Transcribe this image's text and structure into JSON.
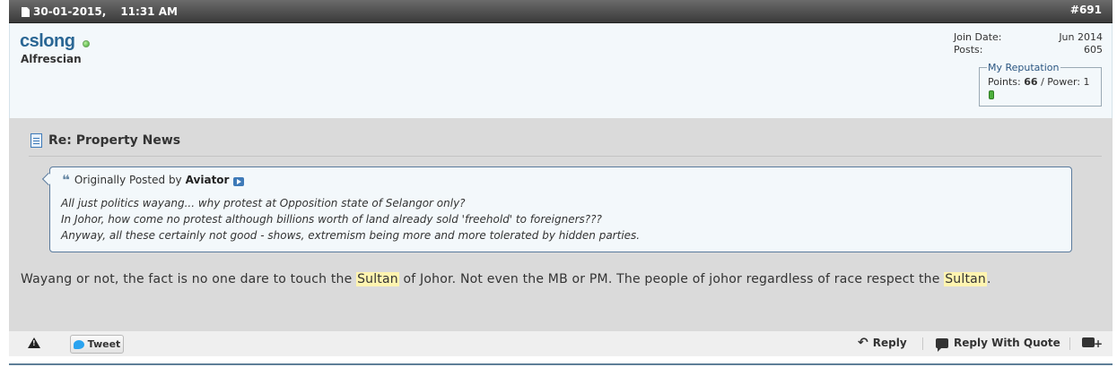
{
  "post": {
    "date": "30-01-2015,",
    "time": "11:31 AM",
    "number": "#691"
  },
  "user": {
    "name": "cslong",
    "title": "Alfrescian",
    "join_label": "Join Date:",
    "join_value": "Jun 2014",
    "posts_label": "Posts:",
    "posts_value": "605",
    "rep_legend": "My Reputation",
    "points_label": "Points:",
    "points_value": "66",
    "power_label": "/ Power: 1"
  },
  "content": {
    "title": "Re: Property News",
    "quote": {
      "prefix": "Originally Posted by",
      "author": "Aviator",
      "lines": [
        "All just politics wayang... why protest at Opposition state of Selangor only?",
        "In Johor, how come no protest although billions worth of land already sold 'freehold' to foreigners???",
        "Anyway, all these certainly not good - shows, extremism being more and more tolerated by hidden parties."
      ]
    },
    "message": {
      "part1": "Wayang or not, the fact is no one dare to touch the",
      "highlight1": "Sultan",
      "part2": "of Johor. Not even the MB or PM. The people of johor regardless of race respect the",
      "highlight2": "Sultan",
      "part3": "."
    }
  },
  "footer": {
    "tweet_label": "Tweet",
    "reply_label": "Reply",
    "reply_quote_label": "Reply With Quote"
  },
  "colors": {
    "username": "#2a6694",
    "header_bg": "#4a4a4a",
    "highlight": "#fff4b0",
    "reputation_bar": "#4caf3c"
  },
  "icons": [
    "document-icon",
    "online-status-icon",
    "title-document-icon",
    "quote-icon",
    "view-post-icon",
    "report-icon",
    "twitter-bird-icon",
    "reply-icon",
    "reply-with-quote-icon",
    "multi-quote-icon"
  ]
}
